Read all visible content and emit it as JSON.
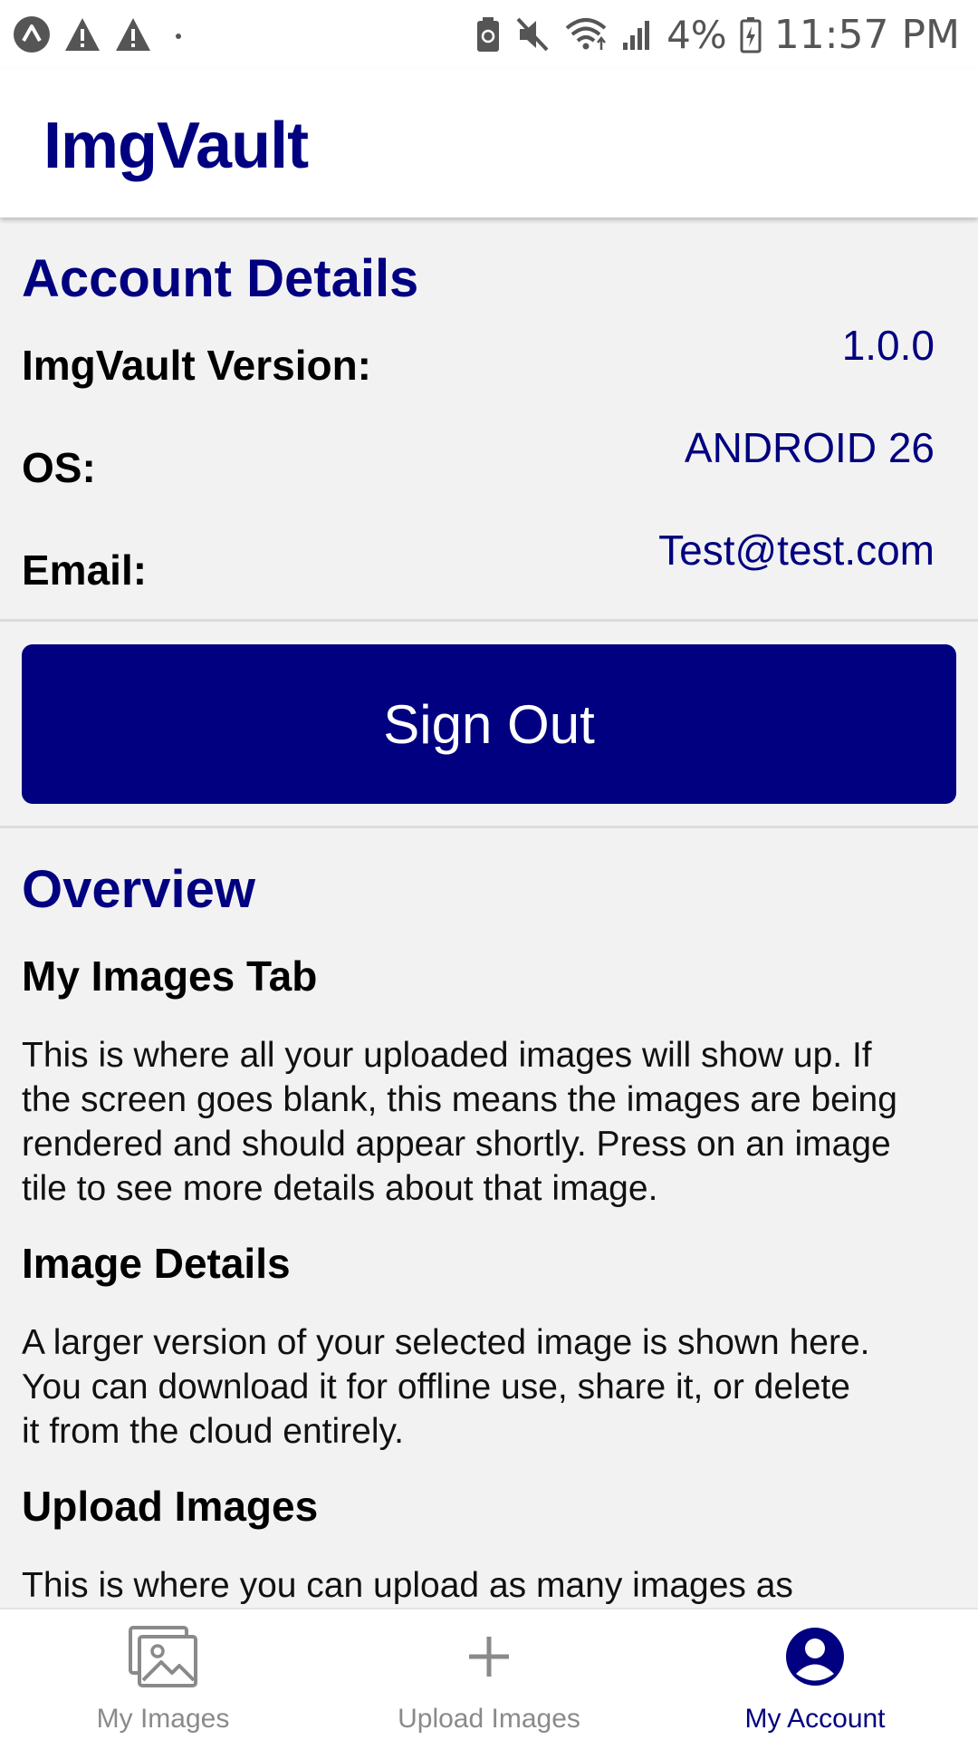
{
  "status_bar": {
    "battery_percent": "4%",
    "time": "11:57 PM"
  },
  "app_bar": {
    "title": "ImgVault"
  },
  "account": {
    "title": "Account Details",
    "version_label": "ImgVault Version:",
    "version_value": "1.0.0",
    "os_label": "OS:",
    "os_value": "ANDROID 26",
    "email_label": "Email:",
    "email_value": "Test@test.com",
    "sign_out_label": "Sign Out"
  },
  "overview": {
    "title": "Overview",
    "sections": [
      {
        "heading": "My Images Tab",
        "lines": [
          "This is where all your uploaded images will show up. If",
          "the screen goes blank, this means the images are being",
          "rendered and should appear shortly. Press on an image",
          "tile to see more details about that image."
        ]
      },
      {
        "heading": "Image Details",
        "lines": [
          "A larger version of your selected image is shown here.",
          "You can download it for offline use, share it, or delete",
          "it from the cloud entirely."
        ]
      },
      {
        "heading": "Upload Images",
        "lines": [
          "This is where you can upload as many images as"
        ]
      }
    ]
  },
  "bottom_nav": {
    "items": [
      {
        "label": "My Images",
        "icon": "image-icon",
        "active": false
      },
      {
        "label": "Upload Images",
        "icon": "plus-icon",
        "active": false
      },
      {
        "label": "My Account",
        "icon": "account-circle-icon",
        "active": true
      }
    ]
  },
  "colors": {
    "brand": "#000080",
    "background": "#f2f2f2",
    "inactive": "#8a8a8a"
  }
}
